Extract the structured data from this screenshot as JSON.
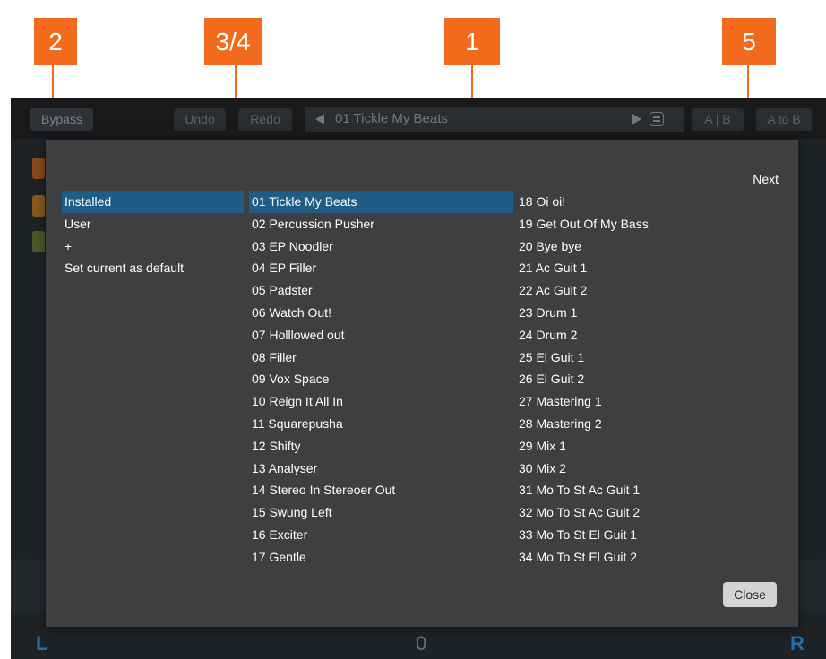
{
  "callouts": [
    "2",
    "3/4",
    "1",
    "5"
  ],
  "toolbar": {
    "bypass": "Bypass",
    "undo": "Undo",
    "redo": "Redo",
    "preset_name": "01 Tickle My Beats",
    "ab": "A | B",
    "a_to_b": "A to B"
  },
  "background": {
    "left_label": "L",
    "right_label": "R",
    "pan_value": "0"
  },
  "browser": {
    "next": "Next",
    "close": "Close",
    "categories": [
      {
        "label": "Installed",
        "selected": true
      },
      {
        "label": "User",
        "selected": false
      },
      {
        "label": "+",
        "selected": false
      },
      {
        "label": "Set current as default",
        "selected": false
      }
    ],
    "presets_col1": [
      "01 Tickle My Beats",
      "02 Percussion Pusher",
      "03 EP Noodler",
      "04 EP Filler",
      "05 Padster",
      "06 Watch Out!",
      "07 Holllowed out",
      "08 Filler",
      "09 Vox Space",
      "10 Reign It All In",
      "11 Squarepusha",
      "12 Shifty",
      "13 Analyser",
      "14 Stereo In Stereoer Out",
      "15 Swung Left",
      "16 Exciter",
      "17 Gentle"
    ],
    "presets_col2": [
      "18 Oi oi!",
      "19 Get Out Of My Bass",
      "20 Bye bye",
      "21 Ac Guit 1",
      "22 Ac Guit 2",
      "23 Drum 1",
      "24 Drum 2",
      "25 El Guit 1",
      "26 El Guit 2",
      "27 Mastering 1",
      "28 Mastering 2",
      "29 Mix 1",
      "30 Mix 2",
      "31 Mo To St Ac Guit 1",
      "32 Mo To St Ac Guit 2",
      "33 Mo To St El Guit 1",
      "34 Mo To St El Guit 2"
    ],
    "selected_preset": "01 Tickle My Beats"
  },
  "colors": {
    "callout": "#f26b1d",
    "selection": "#1d5d86",
    "overlay_bg": "#3d3f41",
    "toolbar_bg": "#17191b",
    "channel_label": "#1d6fb0"
  }
}
